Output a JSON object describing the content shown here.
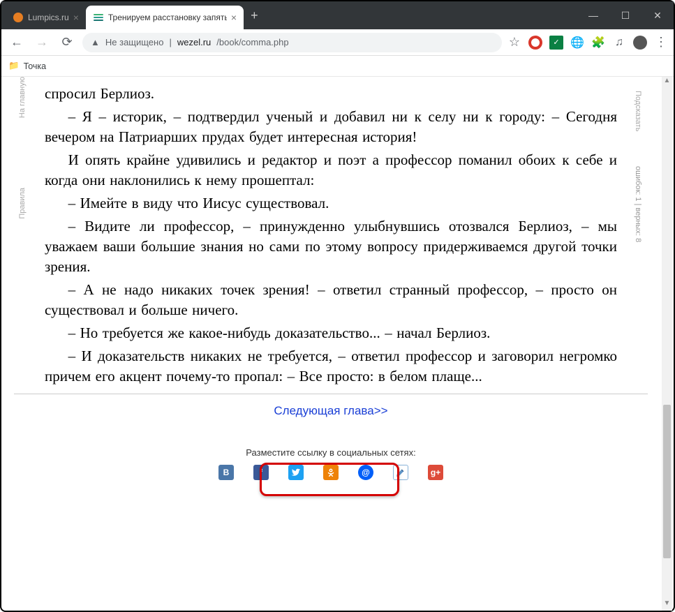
{
  "browser": {
    "tabs": [
      {
        "title": "Lumpics.ru",
        "active": false
      },
      {
        "title": "Тренируем расстановку запяты",
        "active": true
      }
    ],
    "url_insecure_label": "Не защищено",
    "url_host": "wezel.ru",
    "url_path": "/book/comma.php",
    "bookmarks": [
      {
        "label": "Точка"
      }
    ]
  },
  "rail": {
    "left_home": "На главную",
    "left_rules": "Правила",
    "right_hint": "Подсказать",
    "right_stats": "ошибок: 1 | верных: 8"
  },
  "para": {
    "p0": "спросил Берлиоз.",
    "p1": "– Я – историк, – подтвердил ученый и добавил ни к селу ни к городу: – Сегодня вечером на Патриарших прудах будет интересная история!",
    "p2": "И опять крайне удивились и редактор и поэт а профессор поманил обоих к себе и когда они наклонились к нему прошептал:",
    "p3": "– Имейте в виду что Иисус существовал.",
    "p4": "– Видите ли профессор, – принужденно улыбнувшись отозвался Берлиоз, – мы уважаем ваши большие знания но сами по этому вопросу придерживаемся другой точки зрения.",
    "p5": "– А не надо никаких точек зрения! – ответил странный профессор, – просто он существовал и больше ничего.",
    "p6": "– Но требуется же какое-нибудь доказательство... – начал Берлиоз.",
    "p7": "– И доказательств никаких не требуется, – ответил профессор и заговорил негромко причем его акцент почему-то пропал: – Все просто: в белом плаще..."
  },
  "footer": {
    "next_label": "Следующая глава>>",
    "share_label": "Разместите ссылку в социальных сетях:",
    "share": {
      "vk": "VK",
      "fb": "f",
      "tw": "tw",
      "ok": "OK",
      "mail": "@",
      "lj": "LJ",
      "gp": "g+"
    }
  }
}
